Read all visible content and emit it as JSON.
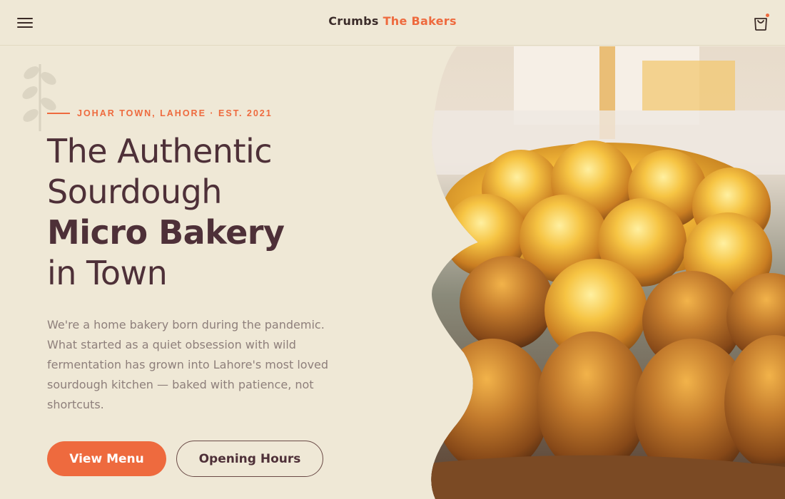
{
  "header": {
    "brand_name": "Crumbs",
    "brand_accent": "The Bakers",
    "menu_icon": "hamburger-menu-icon",
    "cart_icon": "shopping-bag-icon"
  },
  "hero": {
    "eyebrow": "JOHAR TOWN, LAHORE · EST. 2021",
    "headline": {
      "line1": "The Authentic",
      "line2": "Sourdough",
      "line3": "Micro Bakery",
      "line4": "in Town"
    },
    "intro": "We're a home bakery born during the pandemic. What started as a quiet obsession with wild fermentation has grown into Lahore's most loved sourdough kitchen — baked with patience, not shortcuts.",
    "primary_button": "View Menu",
    "secondary_button": "Opening Hours",
    "photo_icon": "bread-rolls-photo",
    "sprig_icon": "wheat-sprig-icon"
  },
  "colors": {
    "background": "#efe8d6",
    "accent": "#ee6a3e",
    "heading": "#4e3038",
    "body_text": "#8e7f7b"
  }
}
